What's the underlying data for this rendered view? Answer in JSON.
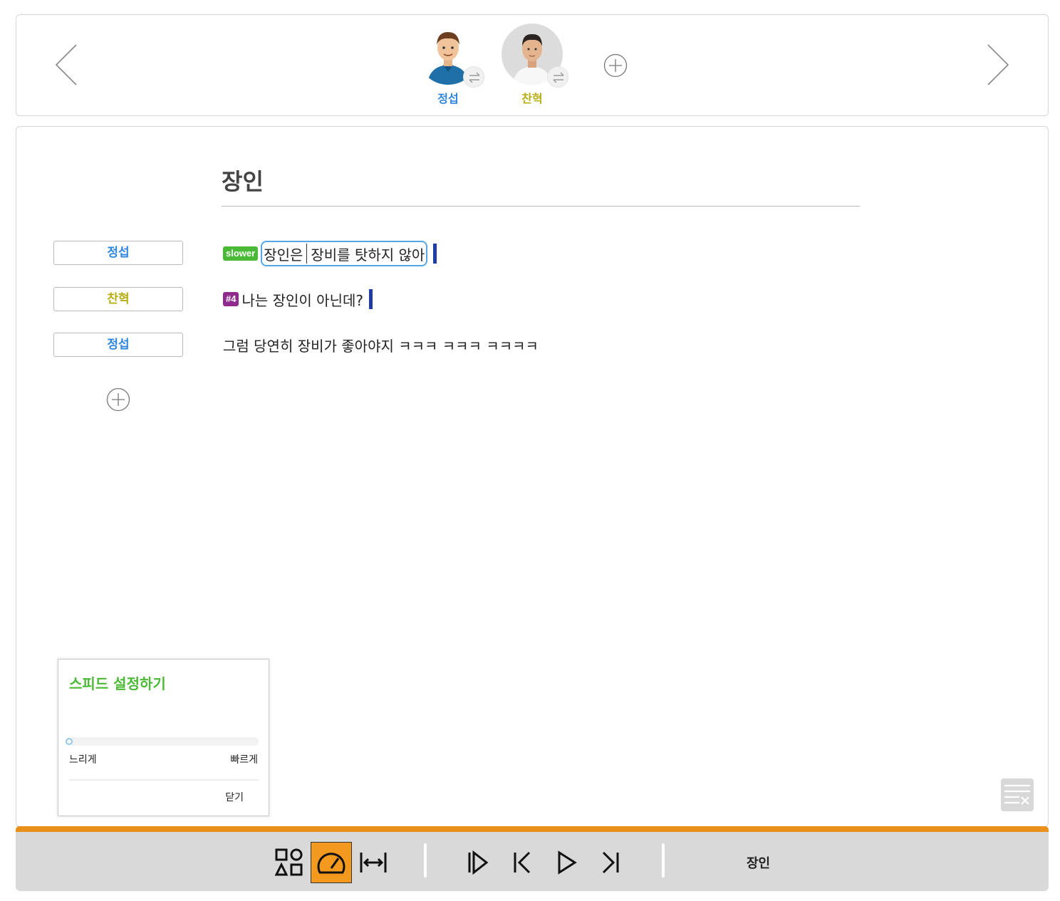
{
  "characters": [
    {
      "name": "정섭",
      "color": "#2e86de",
      "avatar_icon": "cartoon-man-avatar",
      "swap_icon": "swap-arrows-icon"
    },
    {
      "name": "찬혁",
      "color": "#b8ae16",
      "avatar_icon": "photo-man-avatar",
      "swap_icon": "swap-arrows-icon"
    }
  ],
  "script": {
    "title": "장인",
    "lines": [
      {
        "speaker": "정섭",
        "speaker_color": "#2e86de",
        "tag": "slower",
        "tag_color": "#4ab935",
        "text_before_caret": "장인은",
        "text_after_caret": "장비를 탓하지 않아"
      },
      {
        "speaker": "찬혁",
        "speaker_color": "#b8ae16",
        "tag": "#4",
        "tag_color": "#8e2b8c",
        "text": "나는 장인이 아닌데?"
      },
      {
        "speaker": "정섭",
        "speaker_color": "#2e86de",
        "text": "그럼 당연히 장비가 좋아야지 ㅋㅋㅋ ㅋㅋㅋ ㅋㅋㅋㅋ"
      }
    ]
  },
  "speed_popup": {
    "title": "스피드 설정하기",
    "slow_label": "느리게",
    "fast_label": "빠르게",
    "close_label": "닫기",
    "value_fraction": 0.0
  },
  "toolbar": {
    "title": "장인",
    "accent_color": "#e9901b",
    "active_tool": "speed-icon"
  }
}
